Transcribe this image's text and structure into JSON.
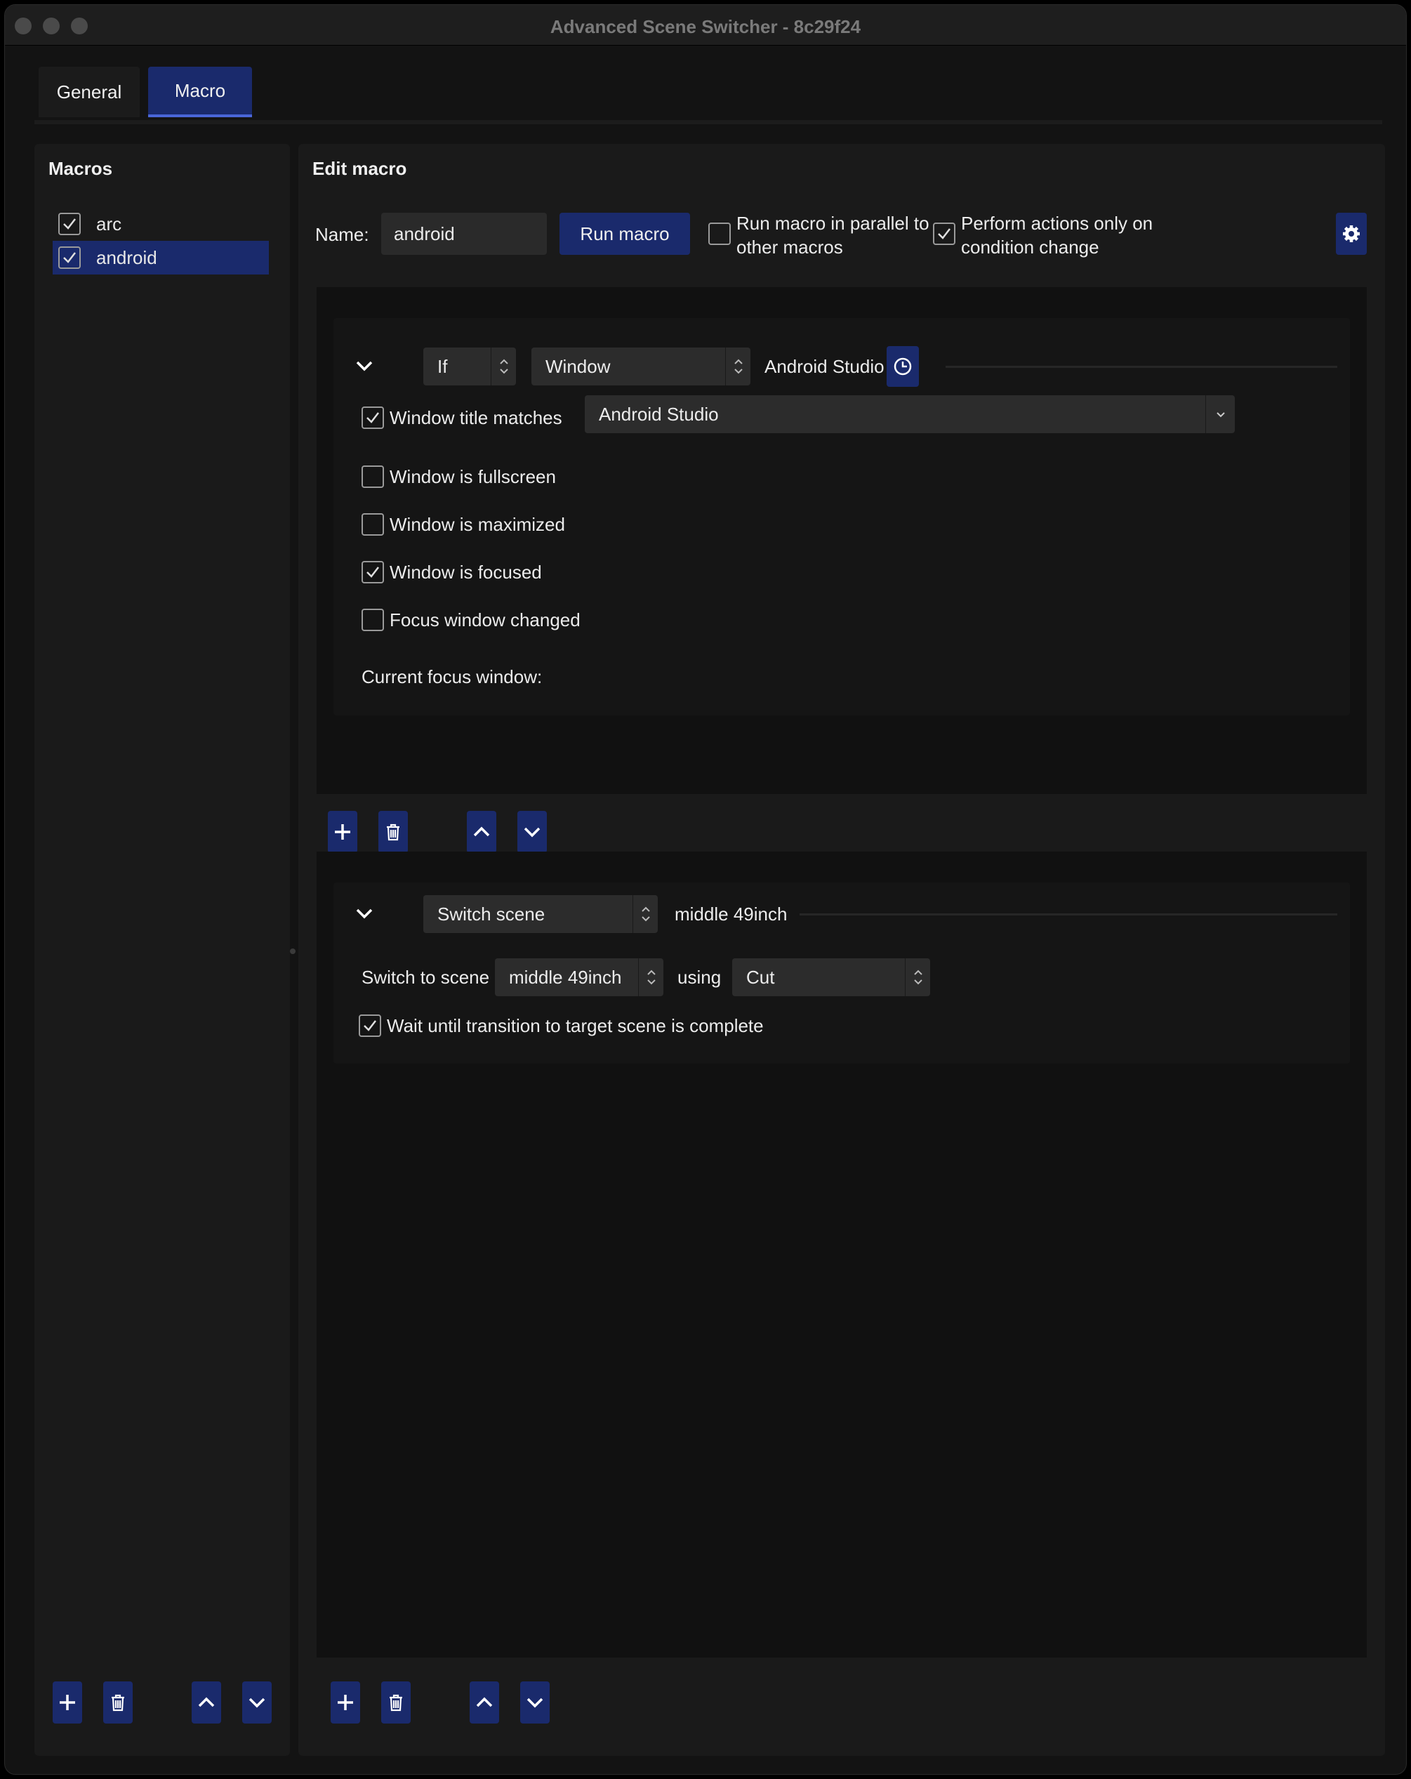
{
  "window": {
    "title": "Advanced Scene Switcher - 8c29f24"
  },
  "tabs": [
    {
      "label": "General"
    },
    {
      "label": "Macro"
    }
  ],
  "macros_panel": {
    "title": "Macros",
    "items": [
      {
        "label": "arc",
        "checked": true,
        "selected": false
      },
      {
        "label": "android",
        "checked": true,
        "selected": true
      }
    ]
  },
  "edit_panel": {
    "title": "Edit macro",
    "name_label": "Name:",
    "name_value": "android",
    "run_button": "Run macro",
    "parallel_label_line1": "Run macro in parallel to",
    "parallel_label_line2": "other macros",
    "parallel_checked": false,
    "on_change_label_line1": "Perform actions only on",
    "on_change_label_line2": "condition change",
    "on_change_checked": true
  },
  "condition": {
    "logic": "If",
    "type": "Window",
    "summary": "Android Studio",
    "title_matches_label": "Window title matches",
    "title_matches_checked": true,
    "title_value": "Android Studio",
    "options": [
      {
        "label": "Window is fullscreen",
        "checked": false
      },
      {
        "label": "Window is maximized",
        "checked": false
      },
      {
        "label": "Window is focused",
        "checked": true
      },
      {
        "label": "Focus window changed",
        "checked": false
      }
    ],
    "current_focus_label": "Current focus window:"
  },
  "action": {
    "type": "Switch scene",
    "summary": "middle 49inch",
    "switch_to_label": "Switch to scene",
    "scene": "middle 49inch",
    "using_label": "using",
    "transition": "Cut",
    "wait_label": "Wait until transition to target scene is complete",
    "wait_checked": true
  },
  "colors": {
    "accent": "#1a2a6c",
    "background": "#131313",
    "panel": "#1a1a1a"
  }
}
